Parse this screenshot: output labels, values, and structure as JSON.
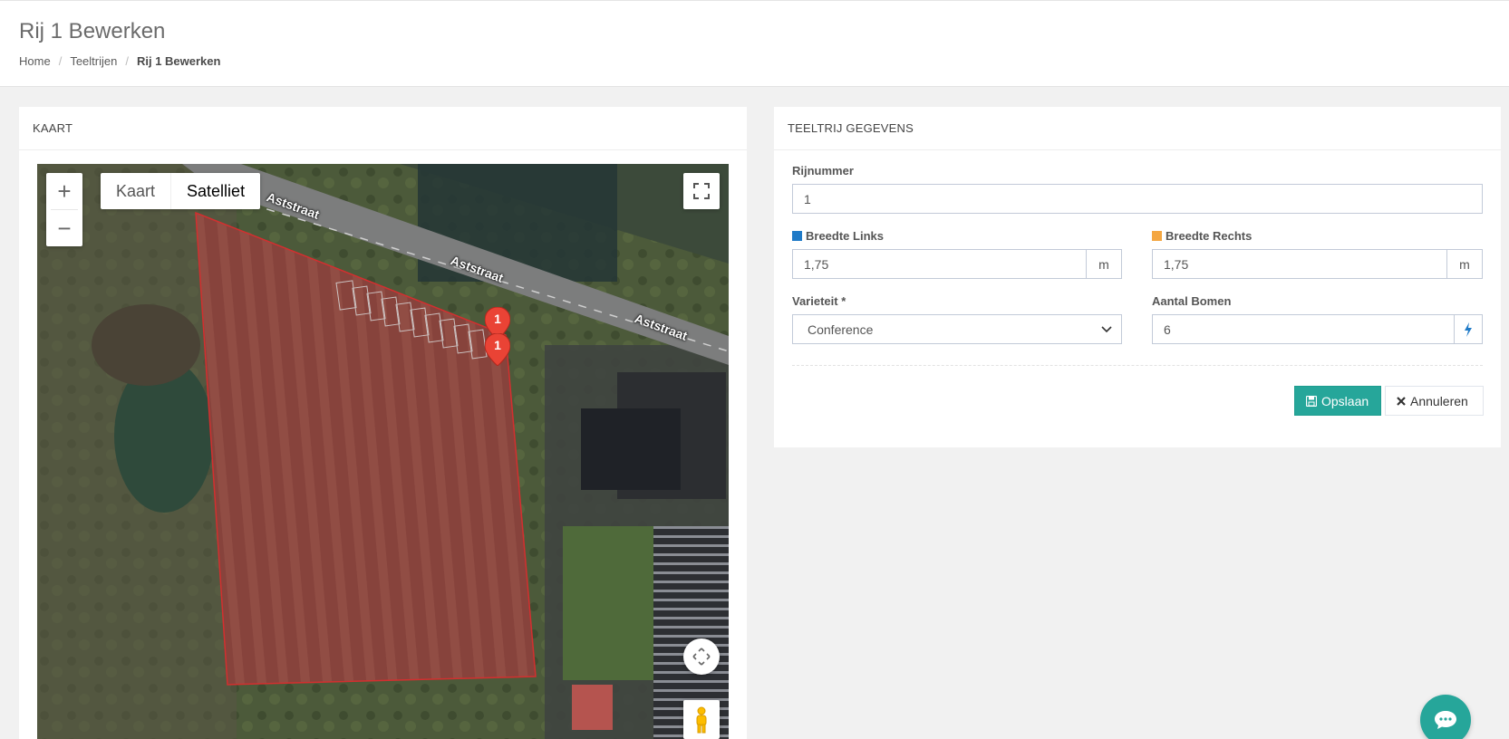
{
  "header": {
    "title": "Rij 1 Bewerken",
    "breadcrumb": [
      "Home",
      "Teeltrijen",
      "Rij 1 Bewerken"
    ]
  },
  "map_card": {
    "title": "KAART",
    "zoom_in": "+",
    "zoom_out": "−",
    "maptype_options": [
      "Kaart",
      "Satelliet"
    ],
    "maptype_selected": "Satelliet",
    "street_labels": [
      "Aststraat",
      "Aststraat",
      "Aststraat"
    ],
    "markers": [
      "1",
      "1"
    ],
    "field_polygon_color": "#d32f2f"
  },
  "form_card": {
    "title": "TEELTRIJ GEGEVENS",
    "rijnummer": {
      "label": "Rijnummer",
      "value": "1"
    },
    "breedte_links": {
      "label": "Breedte Links",
      "value": "1,75",
      "unit": "m",
      "color": "#1f7ac7"
    },
    "breedte_rechts": {
      "label": "Breedte Rechts",
      "value": "1,75",
      "unit": "m",
      "color": "#f4a742"
    },
    "varieteit": {
      "label": "Varieteit *",
      "value": "Conference"
    },
    "aantal_bomen": {
      "label": "Aantal Bomen",
      "value": "6"
    },
    "save_label": "Opslaan",
    "cancel_label": "Annuleren"
  },
  "colors": {
    "accent": "#26a69a",
    "marker": "#ea4335"
  }
}
